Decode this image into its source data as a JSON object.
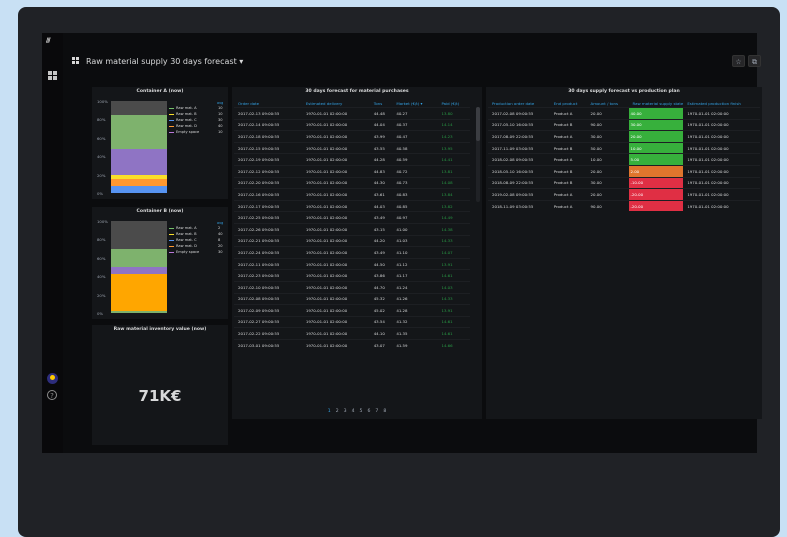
{
  "app": {
    "logo_text": "///",
    "dashboard_title": "Raw material supply 30 days forecast",
    "dropdown_glyph": "▾",
    "star_glyph": "☆",
    "share_glyph": "⧉",
    "help_glyph": "?"
  },
  "container_a": {
    "title": "Container A (now)",
    "yticks": [
      "100%",
      "80%",
      "60%",
      "40%",
      "20%",
      "0%"
    ],
    "legend_header": "avg",
    "segments": [
      {
        "name": "Raw mat. A",
        "value": 10,
        "color": "#73bf69"
      },
      {
        "name": "Raw mat. B",
        "value": 10,
        "color": "#fade2a"
      },
      {
        "name": "Raw mat. C",
        "value": 30,
        "color": "#5794f2"
      },
      {
        "name": "Raw mat. D",
        "value": 40,
        "color": "#ff9830"
      },
      {
        "name": "Empty space",
        "value": 10,
        "color": "#b877d9"
      }
    ],
    "stack_bottom_to_top": [
      {
        "value": 8,
        "color": "#5794f2"
      },
      {
        "value": 7,
        "color": "#ff9830"
      },
      {
        "value": 5,
        "color": "#fade2a"
      },
      {
        "value": 28,
        "color": "#8f74c4"
      },
      {
        "value": 37,
        "color": "#7eb26d"
      },
      {
        "value": 15,
        "color": "#4b4b4b"
      }
    ]
  },
  "container_b": {
    "title": "Container B (now)",
    "yticks": [
      "100%",
      "80%",
      "60%",
      "40%",
      "20%",
      "0%"
    ],
    "legend_header": "avg",
    "segments": [
      {
        "name": "Raw mat. A",
        "value": 2,
        "color": "#73bf69"
      },
      {
        "name": "Raw mat. B",
        "value": 40,
        "color": "#fade2a"
      },
      {
        "name": "Raw mat. C",
        "value": 8,
        "color": "#5794f2"
      },
      {
        "name": "Raw mat. D",
        "value": 20,
        "color": "#ff9830"
      },
      {
        "name": "Empty space",
        "value": 30,
        "color": "#b877d9"
      }
    ],
    "stack_bottom_to_top": [
      {
        "value": 2,
        "color": "#7eb26d"
      },
      {
        "value": 40,
        "color": "#ffa600"
      },
      {
        "value": 8,
        "color": "#8f74c4"
      },
      {
        "value": 20,
        "color": "#7eb26d"
      },
      {
        "value": 30,
        "color": "#4b4b4b"
      }
    ]
  },
  "inventory": {
    "title": "Raw material inventory value (now)",
    "value_text": "71K€",
    "fraction": 0.72,
    "colors": {
      "green": "#37872d",
      "orange": "#e0752d",
      "red": "#c4162a",
      "track": "#2a2c31"
    }
  },
  "purchases": {
    "title": "30 days forecast for material purchases",
    "columns": [
      "Order date",
      "Estimated delivery",
      "Tons",
      "Market (€/t) ▾",
      "Paid (€/t)"
    ],
    "rows": [
      [
        "2017-02-13 09:00:55",
        "1970-01-01 02:00:00",
        "44.48",
        "40.27",
        "13.80"
      ],
      [
        "2017-02-14 09:00:55",
        "1970-01-01 02:00:00",
        "44.04",
        "40.37",
        "14.14"
      ],
      [
        "2017-02-18 09:00:55",
        "1970-01-01 02:00:00",
        "43.99",
        "40.47",
        "14.23"
      ],
      [
        "2017-02-15 09:00:55",
        "1970-01-01 02:00:00",
        "43.55",
        "40.58",
        "13.95"
      ],
      [
        "2017-02-19 09:00:55",
        "1970-01-01 02:00:00",
        "44.28",
        "40.59",
        "14.41"
      ],
      [
        "2017-02-12 09:00:55",
        "1970-01-01 02:00:00",
        "44.83",
        "40.72",
        "13.81"
      ],
      [
        "2017-02-20 09:00:55",
        "1970-01-01 02:00:00",
        "44.30",
        "40.73",
        "14.08"
      ],
      [
        "2017-02-16 09:00:55",
        "1970-01-01 02:00:00",
        "43.61",
        "40.83",
        "13.84"
      ],
      [
        "2017-02-17 09:00:55",
        "1970-01-01 02:00:00",
        "44.03",
        "40.85",
        "13.82"
      ],
      [
        "2017-02-25 09:00:55",
        "1970-01-01 02:00:00",
        "43.49",
        "40.97",
        "14.49"
      ],
      [
        "2017-02-26 09:00:55",
        "1970-01-01 02:00:00",
        "43.15",
        "41.00",
        "14.38"
      ],
      [
        "2017-02-21 09:00:55",
        "1970-01-01 02:00:00",
        "44.20",
        "41.03",
        "14.33"
      ],
      [
        "2017-02-24 09:00:55",
        "1970-01-01 02:00:00",
        "43.49",
        "41.10",
        "14.07"
      ],
      [
        "2017-02-11 09:00:55",
        "1970-01-01 02:00:00",
        "44.50",
        "41.12",
        "13.91"
      ],
      [
        "2017-02-23 09:00:55",
        "1970-01-01 02:00:00",
        "43.86",
        "41.17",
        "14.61"
      ],
      [
        "2017-02-10 09:00:55",
        "1970-01-01 02:00:00",
        "44.70",
        "41.24",
        "14.03"
      ],
      [
        "2017-02-08 09:00:55",
        "1970-01-01 02:00:00",
        "45.32",
        "41.26",
        "14.33"
      ],
      [
        "2017-02-09 09:00:55",
        "1970-01-01 02:00:00",
        "45.02",
        "41.28",
        "13.91"
      ],
      [
        "2017-02-27 09:00:55",
        "1970-01-01 02:00:00",
        "43.54",
        "41.32",
        "14.61"
      ],
      [
        "2017-02-22 09:00:55",
        "1970-01-01 02:00:00",
        "44.10",
        "41.35",
        "14.61"
      ],
      [
        "2017-03-01 09:00:55",
        "1970-01-01 02:00:00",
        "43.07",
        "41.59",
        "14.66"
      ]
    ],
    "pages": [
      "1",
      "2",
      "3",
      "4",
      "5",
      "6",
      "7",
      "8"
    ],
    "current_page": "1"
  },
  "plan": {
    "title": "30 days supply forecast vs production plan",
    "columns": [
      "Production order date",
      "End product",
      "Amount / tons",
      "Raw material supply state",
      "Estimated production finish"
    ],
    "rows": [
      [
        "2017-02-08 09:00:55",
        "Product A",
        "20.00",
        "40.00",
        "1970-01-01 02:00:00"
      ],
      [
        "2017-05-10 16:00:55",
        "Product B",
        "90.00",
        "30.00",
        "1970-01-01 02:00:00"
      ],
      [
        "2017-08-09 22:00:55",
        "Product A",
        "30.00",
        "20.00",
        "1970-01-01 02:00:00"
      ],
      [
        "2017-11-09 03:00:55",
        "Product B",
        "50.00",
        "10.00",
        "1970-01-01 02:00:00"
      ],
      [
        "2018-02-08 09:00:55",
        "Product A",
        "10.00",
        "5.00",
        "1970-01-01 02:00:00"
      ],
      [
        "2018-05-10 16:00:55",
        "Product B",
        "20.00",
        "2.00",
        "1970-01-01 02:00:00"
      ],
      [
        "2018-08-09 22:00:55",
        "Product B",
        "30.00",
        "-10.00",
        "1970-01-01 02:00:00"
      ],
      [
        "2019-02-08 09:00:55",
        "Product A",
        "20.00",
        "-20.00",
        "1970-01-01 02:00:00"
      ],
      [
        "2018-11-09 03:00:55",
        "Product A",
        "90.00",
        "-20.00",
        "1970-01-01 02:00:00"
      ]
    ],
    "state_colors": [
      "#37b03c",
      "#37b03c",
      "#37b03c",
      "#37b03c",
      "#37b03c",
      "#e0752d",
      "#e02f44",
      "#e02f44",
      "#e02f44"
    ]
  }
}
